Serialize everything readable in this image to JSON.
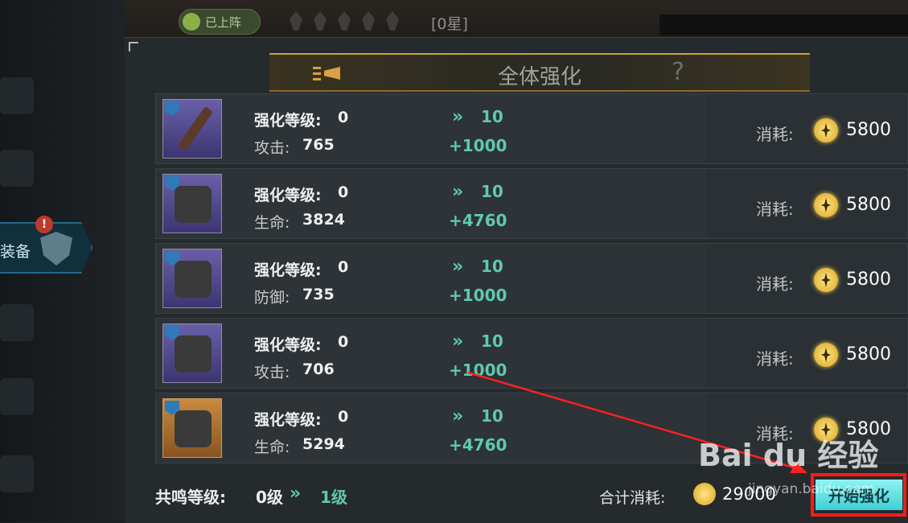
{
  "header": {
    "deployed_badge": "已上阵",
    "star_text": "[0星]"
  },
  "sidebar": {
    "equip_label": "装备",
    "alert": "!"
  },
  "dialog": {
    "title": "全体强化",
    "help": "?"
  },
  "labels": {
    "level_label": "强化等级:",
    "cost_label": "消耗:",
    "arrow": "»"
  },
  "items": [
    {
      "level": "0",
      "stat_label": "攻击:",
      "stat_value": "765",
      "target_level": "10",
      "bonus": "+1000",
      "cost": "5800",
      "type": "weapon"
    },
    {
      "level": "0",
      "stat_label": "生命:",
      "stat_value": "3824",
      "target_level": "10",
      "bonus": "+4760",
      "cost": "5800",
      "type": "helmet"
    },
    {
      "level": "0",
      "stat_label": "防御:",
      "stat_value": "735",
      "target_level": "10",
      "bonus": "+1000",
      "cost": "5800",
      "type": "armor"
    },
    {
      "level": "0",
      "stat_label": "攻击:",
      "stat_value": "706",
      "target_level": "10",
      "bonus": "+1000",
      "cost": "5800",
      "type": "bracer"
    },
    {
      "level": "0",
      "stat_label": "生命:",
      "stat_value": "5294",
      "target_level": "10",
      "bonus": "+4760",
      "cost": "5800",
      "type": "boots"
    }
  ],
  "footer": {
    "resonance_label": "共鸣等级:",
    "resonance_current": "0级",
    "resonance_next": "1级",
    "total_label": "合计消耗:",
    "total_value": "29000",
    "start_button": "开始强化"
  },
  "watermark": {
    "text": "Bai du 经验",
    "url": "jingyan.baidu.com"
  },
  "colors": {
    "accent_teal": "#5fc9ae",
    "title_gold": "#c9a243",
    "button_cyan": "#3ed0d4",
    "highlight_red": "#ff1a1a"
  }
}
